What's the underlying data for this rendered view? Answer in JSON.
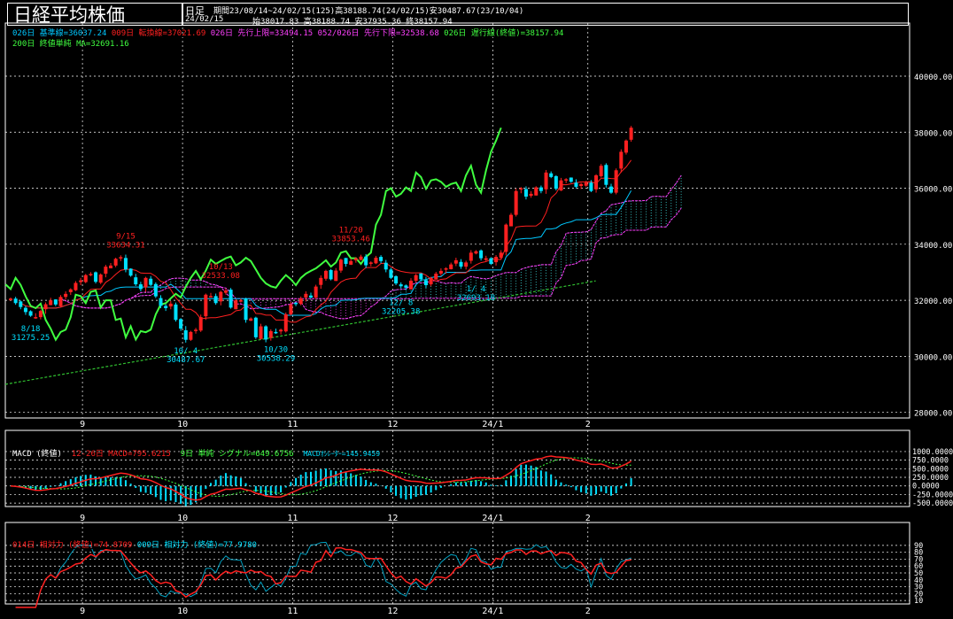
{
  "header": {
    "title": "日経平均株価",
    "timeframe": "日足",
    "period": "期間23/08/14~24/02/15(125)高38188.74(24/02/15)安30487.67(23/10/04)",
    "date": "24/02/15",
    "ohlc": "始38017.83 高38188.74 安37935.36 終38157.94"
  },
  "legends": {
    "main": [
      {
        "text": "026日 基準線=36037.24",
        "color": "#00c8ff"
      },
      {
        "text": "009日 転換線=37021.69",
        "color": "#ff2020"
      },
      {
        "text": "026日 先行上限=33494.15",
        "color": "#ff40ff"
      },
      {
        "text": "052/026日 先行下限=32538.68",
        "color": "#ff40ff"
      },
      {
        "text": "026日 遅行線(終値)=38157.94",
        "color": "#40ff40"
      }
    ],
    "main2": [
      {
        "text": "200日 終値単純 MA=32691.16",
        "color": "#40ff40"
      }
    ],
    "macd": [
      {
        "text": "MACD (終値)",
        "color": "#ffffff"
      },
      {
        "text": "12-26日 MACD=795.6215",
        "color": "#ff2020"
      },
      {
        "text": "9日 単純 シグナル=649.6756",
        "color": "#40ff40"
      },
      {
        "text": "MACDｵｼﾚｰﾀｰ=145.9459",
        "color": "#00e0ff"
      }
    ],
    "rsi": [
      {
        "text": "014日 相対力 (終値)=74.8709",
        "color": "#ff2020"
      },
      {
        "text": "009日 相対力 (終値)=77.9780",
        "color": "#00e0ff"
      }
    ]
  },
  "colors": {
    "up": "#ff2020",
    "down": "#00e0ff",
    "kijun": "#00c8ff",
    "tenkan": "#ff2020",
    "span": "#ff40ff",
    "chikou": "#40ff40",
    "ma": "#30c030",
    "grid": "#ffffff",
    "axis": "#ffffff"
  },
  "x_axis_labels": [
    {
      "label": "9",
      "index": 14
    },
    {
      "label": "10",
      "index": 34
    },
    {
      "label": "11",
      "index": 56
    },
    {
      "label": "12",
      "index": 76
    },
    {
      "label": "24/1",
      "index": 96
    },
    {
      "label": "2",
      "index": 115
    }
  ],
  "chart_data": [
    {
      "type": "candlestick",
      "title": "日経平均株価",
      "yticks": [
        "40000.00",
        "38000.00",
        "36000.00",
        "34000.00",
        "32000.00",
        "30000.00",
        "28000.00"
      ],
      "ylim": [
        27800,
        41200
      ],
      "n_sessions": 125,
      "forward_sessions": 26,
      "close": [
        32060,
        31900,
        31760,
        31580,
        31450,
        31400,
        31620,
        31860,
        32000,
        31850,
        32120,
        32230,
        32390,
        32620,
        32710,
        32900,
        32940,
        32660,
        32920,
        33200,
        33240,
        33480,
        33540,
        33100,
        32880,
        32570,
        32400,
        32800,
        32550,
        32140,
        31800,
        31720,
        31880,
        31300,
        30990,
        30590,
        30870,
        30950,
        31400,
        32200,
        32150,
        31900,
        32300,
        32350,
        31740,
        32000,
        32000,
        31300,
        31350,
        30680,
        31070,
        30600,
        30900,
        30860,
        30950,
        31500,
        31850,
        31900,
        32070,
        32230,
        32100,
        32490,
        32800,
        33050,
        32750,
        33060,
        33450,
        33300,
        33400,
        33500,
        33560,
        33250,
        33350,
        33520,
        33400,
        33100,
        32800,
        32600,
        32500,
        32450,
        32700,
        32900,
        32750,
        32540,
        32800,
        32950,
        33050,
        33140,
        33280,
        33430,
        33200,
        33350,
        33700,
        33750,
        33500,
        33500,
        33300,
        33550,
        33700,
        34700,
        35050,
        35900,
        36000,
        35700,
        35800,
        36030,
        35900,
        36560,
        36400,
        35980,
        36280,
        36320,
        36230,
        36050,
        36150,
        36200,
        35900,
        36460,
        36800,
        36120,
        35840,
        36640,
        37300,
        37700,
        38158
      ],
      "yearly_high_low_labels": [
        {
          "text": "9/15",
          "sub": "33634.31",
          "index": 23,
          "price": 33634,
          "color": "#ff2020",
          "above": true
        },
        {
          "text": "10/13",
          "sub": "32533.08",
          "index": 42,
          "price": 32533,
          "color": "#ff2020",
          "above": true
        },
        {
          "text": "11/20",
          "sub": "33853.46",
          "index": 68,
          "price": 33853,
          "color": "#ff2020",
          "above": true
        },
        {
          "text": "8/18",
          "sub": "31275.25",
          "index": 4,
          "price": 31275,
          "color": "#00e0ff",
          "above": false
        },
        {
          "text": "10/ 4",
          "sub": "30487.67",
          "index": 35,
          "price": 30487,
          "color": "#00e0ff",
          "above": false
        },
        {
          "text": "10/30",
          "sub": "30538.29",
          "index": 53,
          "price": 30538,
          "color": "#00e0ff",
          "above": false
        },
        {
          "text": "12/ 8",
          "sub": "32205.38",
          "index": 78,
          "price": 32205,
          "color": "#00e0ff",
          "above": false
        },
        {
          "text": "1/ 4",
          "sub": "32693.18",
          "index": 93,
          "price": 32693,
          "color": "#00e0ff",
          "above": false
        }
      ],
      "ma200_start": 29000,
      "ma200_end": 32691
    },
    {
      "type": "line",
      "title": "MACD (終値)",
      "yticks": [
        "1000.0000",
        "750.0000",
        "500.0000",
        "250.0000",
        "0.0000",
        "-250.0000",
        "-500.0000"
      ],
      "ylim": [
        -600,
        1050
      ],
      "macd_last": 795.6215,
      "signal_last": 649.6756,
      "osc_last": 145.9459
    },
    {
      "type": "line",
      "title": "相対力 (終値)",
      "yticks": [
        "90",
        "80",
        "70",
        "60",
        "50",
        "40",
        "30",
        "20",
        "10"
      ],
      "ylim": [
        5,
        95
      ],
      "rsi14_last": 74.8709,
      "rsi9_last": 77.978
    }
  ]
}
